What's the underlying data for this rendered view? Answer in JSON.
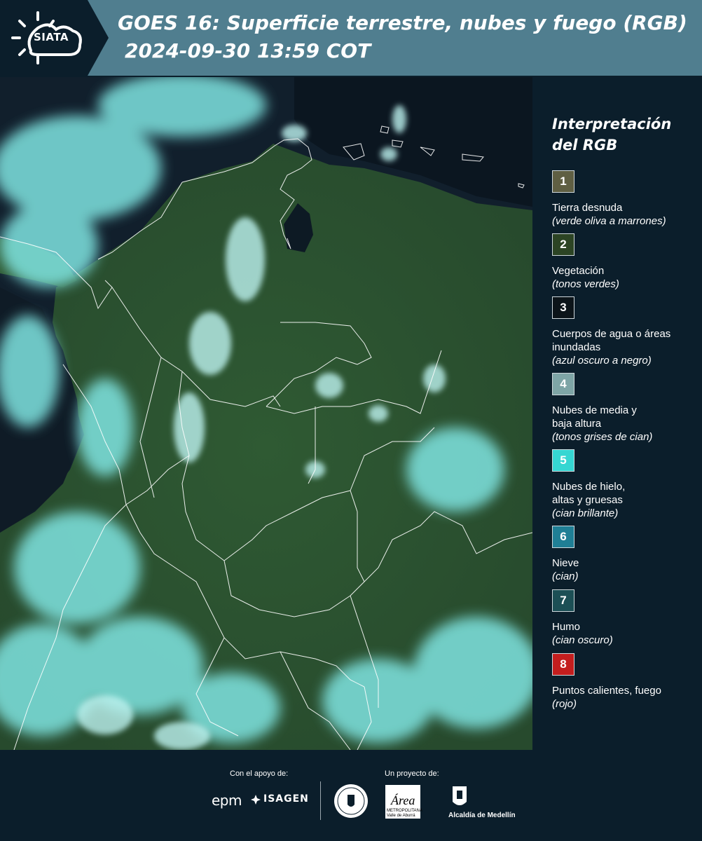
{
  "header": {
    "logo_text": "SIATA",
    "title": "GOES 16: Superficie terrestre, nubes y fuego (RGB)",
    "subtitle": "2024-09-30 13:59 COT"
  },
  "map": {
    "description_icon": "satellite-rgb-image",
    "colors": {
      "ocean": "#0f1d2a",
      "land": "#2f5a33",
      "cloud": "#7ee3e0",
      "boundary": "#ffffff"
    }
  },
  "legend": {
    "title_line1": "Interpretación",
    "title_line2": "del RGB",
    "items": [
      {
        "number": "1",
        "label": "Tierra desnuda",
        "desc": "(verde oliva a marrones)",
        "color": "#5f5f43"
      },
      {
        "number": "2",
        "label": "Vegetación",
        "desc": "(tonos verdes)",
        "color": "#2c4424"
      },
      {
        "number": "3",
        "label": "Cuerpos de agua o áreas inundadas",
        "desc": "(azul oscuro a negro)",
        "color": "#0c1419"
      },
      {
        "number": "4",
        "label": "Nubes de media y baja altura",
        "desc": "(tonos grises de cian)",
        "color": "#7ea5a6"
      },
      {
        "number": "5",
        "label": "Nubes de hielo, altas y gruesas",
        "desc": "(cian brillante)",
        "color": "#35d6d2"
      },
      {
        "number": "6",
        "label": "Nieve",
        "desc": "(cian)",
        "color": "#1f7f95"
      },
      {
        "number": "7",
        "label": "Humo",
        "desc": "(cian oscuro)",
        "color": "#1c4f55"
      },
      {
        "number": "8",
        "label": "Puntos calientes, fuego",
        "desc": "(rojo)",
        "color": "#c41e1e"
      }
    ]
  },
  "footer": {
    "support_label": "Con el apoyo de:",
    "project_label": "Un proyecto de:",
    "epm_logo": "epm",
    "isagen_logo": "ISAGEN",
    "area_logo": "Área",
    "area_subtext": "METROPOLITANA Valle de Aburrá",
    "alcaldia_logo": "Alcaldía de Medellín",
    "seal_logo": "universidad-seal-icon"
  }
}
